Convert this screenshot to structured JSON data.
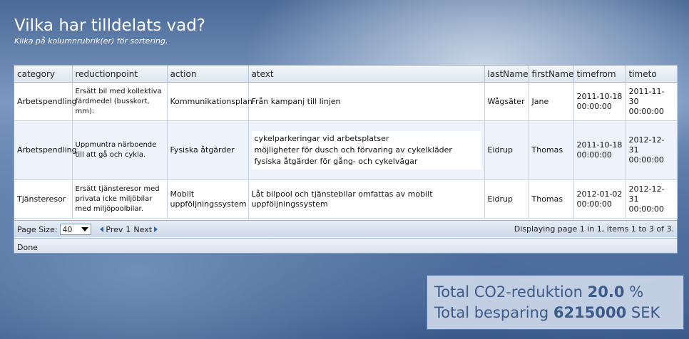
{
  "page": {
    "title": "Vilka har tilldelats vad?",
    "subtitle": "Klika på kolumnrubrik(er) för sortering."
  },
  "table": {
    "headers": [
      "category",
      "reductionpoint",
      "action",
      "atext",
      "lastName",
      "firstName",
      "timefrom",
      "timeto"
    ],
    "rows": [
      {
        "category": "Arbetspendling",
        "reductionpoint": "Ersätt bil med kollektiva färdmedel (busskort, mm).",
        "action": "Kommunikationsplan",
        "atext": [
          "Från kampanj till linjen"
        ],
        "lastName": "Wågsäter",
        "firstName": "Jane",
        "timefrom": [
          "2011-10-18",
          "00:00:00"
        ],
        "timeto": [
          "2011-11-30",
          "00:00:00"
        ]
      },
      {
        "category": "Arbetspendling",
        "reductionpoint": "Uppmuntra närboende till att gå och cykla.",
        "action": "Fysiska åtgärder",
        "atext": [
          "cykelparkeringar vid arbetsplatser",
          "möjligheter för dusch och förvaring av cykelkläder",
          "fysiska åtgärder för gång- och cykelvägar"
        ],
        "lastName": "Eidrup",
        "firstName": "Thomas",
        "timefrom": [
          "2011-10-18",
          "00:00:00"
        ],
        "timeto": [
          "2012-12-31",
          "00:00:00"
        ]
      },
      {
        "category": "Tjänsteresor",
        "reductionpoint": "Ersätt tjänsteresor med privata icke miljöbilar med miljöpoolbilar.",
        "action": "Mobilt uppföljningssystem",
        "atext": [
          "Låt bilpool och tjänstebilar omfattas av mobilt uppföljningssystem"
        ],
        "lastName": "Eidrup",
        "firstName": "Thomas",
        "timefrom": [
          "2012-01-02",
          "00:00:00"
        ],
        "timeto": [
          "2012-12-31",
          "00:00:00"
        ]
      }
    ]
  },
  "pager": {
    "page_size_label": "Page Size:",
    "page_size_value": "40",
    "prev": "Prev",
    "page_num": "1",
    "next": "Next",
    "info": "Displaying page 1 in 1, items 1 to 3 of 3."
  },
  "status": "Done",
  "totals": {
    "co2_label": "Total CO2-reduktion",
    "co2_value": "20.0",
    "co2_unit": "%",
    "saving_label": "Total besparing",
    "saving_value": "6215000",
    "saving_unit": "SEK"
  }
}
